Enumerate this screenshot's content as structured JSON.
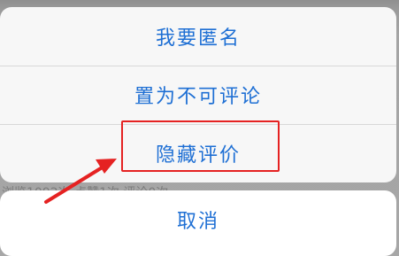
{
  "background": {
    "partial_text": "浏览1092次 点赞1次 评论0次"
  },
  "action_sheet": {
    "items": [
      {
        "label": "我要匿名"
      },
      {
        "label": "置为不可评论"
      },
      {
        "label": "隐藏评价"
      }
    ],
    "cancel_label": "取消"
  },
  "annotation": {
    "highlight_color": "#e52222",
    "accent_color": "#1e6fd4"
  }
}
